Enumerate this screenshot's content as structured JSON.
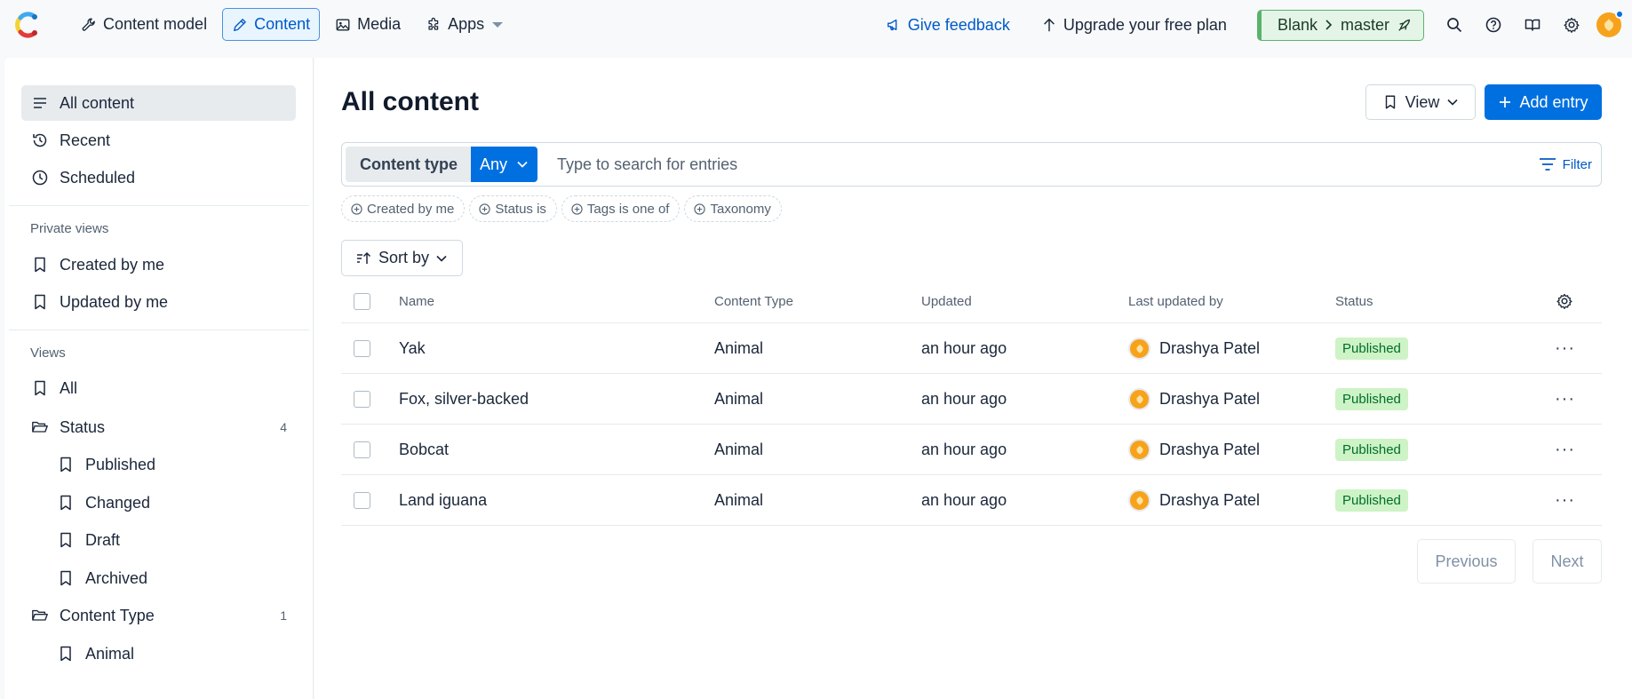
{
  "topbar": {
    "nav": [
      {
        "label": "Content model",
        "icon": "wrench-icon"
      },
      {
        "label": "Content",
        "icon": "pen-icon",
        "active": true
      },
      {
        "label": "Media",
        "icon": "image-icon"
      },
      {
        "label": "Apps",
        "icon": "puzzle-icon"
      }
    ],
    "feedback": "Give feedback",
    "upgrade": "Upgrade your free plan",
    "env_space": "Blank",
    "env_branch": "master",
    "colors": {
      "accent": "#0070e0",
      "env_green": "#59b36b"
    }
  },
  "sidebar": {
    "top_items": [
      {
        "label": "All content",
        "icon": "list-icon"
      },
      {
        "label": "Recent",
        "icon": "history-icon"
      },
      {
        "label": "Scheduled",
        "icon": "clock-icon"
      }
    ],
    "private_views_title": "Private views",
    "private_views": [
      {
        "label": "Created by me"
      },
      {
        "label": "Updated by me"
      }
    ],
    "views_title": "Views",
    "views": {
      "all": "All",
      "status_folder": "Status",
      "status_count": "4",
      "status_items": [
        "Published",
        "Changed",
        "Draft",
        "Archived"
      ],
      "ct_folder": "Content Type",
      "ct_count": "1",
      "ct_items": [
        "Animal"
      ]
    }
  },
  "main": {
    "title": "All content",
    "view_label": "View",
    "add_label": "Add entry",
    "content_type_label": "Content type",
    "content_type_value": "Any",
    "search_placeholder": "Type to search for entries",
    "filter_label": "Filter",
    "chips": [
      "Created by me",
      "Status is",
      "Tags is one of",
      "Taxonomy"
    ],
    "sort_label": "Sort by",
    "columns": {
      "name": "Name",
      "type": "Content Type",
      "updated": "Updated",
      "by": "Last updated by",
      "status": "Status"
    },
    "rows": [
      {
        "name": "Yak",
        "type": "Animal",
        "updated": "an hour ago",
        "by": "Drashya Patel",
        "status": "Published"
      },
      {
        "name": "Fox, silver-backed",
        "type": "Animal",
        "updated": "an hour ago",
        "by": "Drashya Patel",
        "status": "Published"
      },
      {
        "name": "Bobcat",
        "type": "Animal",
        "updated": "an hour ago",
        "by": "Drashya Patel",
        "status": "Published"
      },
      {
        "name": "Land iguana",
        "type": "Animal",
        "updated": "an hour ago",
        "by": "Drashya Patel",
        "status": "Published"
      }
    ],
    "previous_label": "Previous",
    "next_label": "Next"
  }
}
